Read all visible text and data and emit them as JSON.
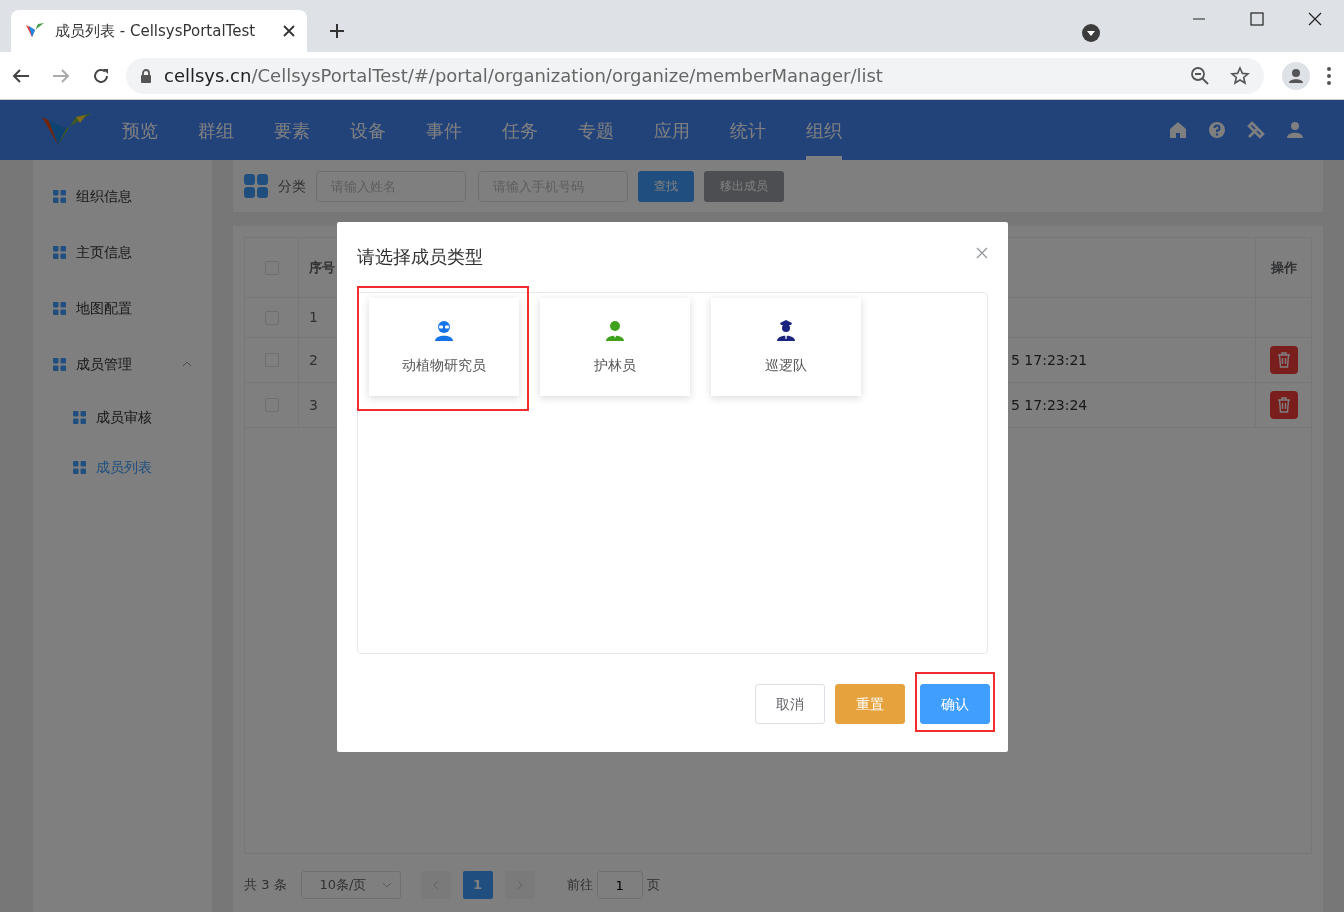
{
  "browser": {
    "tab_title": "成员列表 - CellsysPortalTest",
    "url_host": "cellsys.cn",
    "url_path": "/CellsysPortalTest/#/portal/organization/organize/memberManager/list"
  },
  "nav": {
    "items": [
      {
        "label": "预览",
        "selected": false
      },
      {
        "label": "群组",
        "selected": false
      },
      {
        "label": "要素",
        "selected": false
      },
      {
        "label": "设备",
        "selected": false
      },
      {
        "label": "事件",
        "selected": false
      },
      {
        "label": "任务",
        "selected": false
      },
      {
        "label": "专题",
        "selected": false
      },
      {
        "label": "应用",
        "selected": false
      },
      {
        "label": "统计",
        "selected": false
      },
      {
        "label": "组织",
        "selected": true
      }
    ]
  },
  "sidebar": {
    "items": [
      {
        "label": "组织信息",
        "selected": false
      },
      {
        "label": "主页信息",
        "selected": false
      },
      {
        "label": "地图配置",
        "selected": false
      },
      {
        "label": "成员管理",
        "selected": false,
        "expanded": true,
        "children": [
          {
            "label": "成员审核",
            "selected": false
          },
          {
            "label": "成员列表",
            "selected": true
          }
        ]
      }
    ]
  },
  "toolbar": {
    "label": "分类",
    "name_placeholder": "请输入姓名",
    "phone_placeholder": "请输入手机号码",
    "search_button": "查找",
    "remove_button": {
      "label": "移出成员",
      "disabled": true
    }
  },
  "table": {
    "header_checked": false,
    "columns": [
      "序号",
      "操作"
    ],
    "rows": [
      {
        "index": "1",
        "time": "",
        "checked": false,
        "deletable": false
      },
      {
        "index": "2",
        "time": "5 17:23:21",
        "checked": false,
        "deletable": true
      },
      {
        "index": "3",
        "time": "5 17:23:24",
        "checked": false,
        "deletable": true
      }
    ]
  },
  "pagination": {
    "total": "共 3 条",
    "page_size": "10条/页",
    "pages": [
      {
        "label": "1",
        "selected": true
      }
    ],
    "goto_label": "前往",
    "goto_value": "1",
    "page_unit": "页"
  },
  "dialog": {
    "title": "请选择成员类型",
    "options": [
      {
        "label": "动植物研究员",
        "kind": "researcher",
        "color": "#1473e6",
        "highlighted": true
      },
      {
        "label": "护林员",
        "kind": "ranger",
        "color": "#3fa21c",
        "highlighted": false
      },
      {
        "label": "巡逻队",
        "kind": "patrol",
        "color": "#1a237e",
        "highlighted": false
      }
    ],
    "buttons": [
      {
        "label": "取消",
        "kind": "default",
        "highlighted": false
      },
      {
        "label": "重置",
        "kind": "warning",
        "highlighted": false
      },
      {
        "label": "确认",
        "kind": "primary",
        "highlighted": true
      }
    ]
  }
}
